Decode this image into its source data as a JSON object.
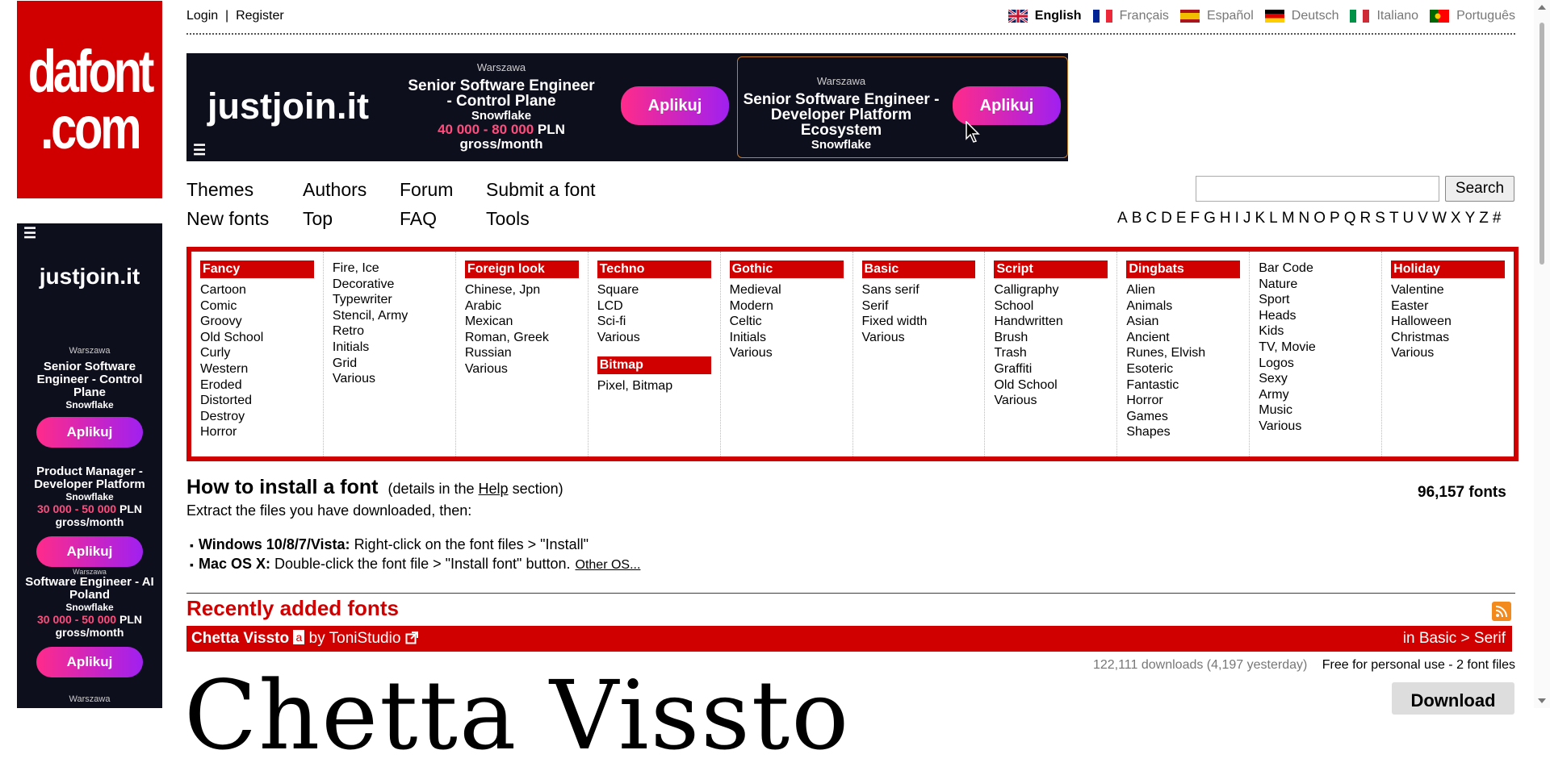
{
  "logo": {
    "line1": "dafont",
    "line2": ".com"
  },
  "side_ad": {
    "menu_icon": "menu-icon",
    "brand": "justjoin.it",
    "jobs": [
      {
        "city": "Warszawa",
        "title": "Senior Software Engineer - Control Plane",
        "company": "Snowflake",
        "salary_range": "",
        "salary_suffix": "",
        "cta": "Aplikuj"
      },
      {
        "city": "",
        "title": "Product Manager - Developer Platform",
        "company": "Snowflake",
        "salary_range": "30 000 - 50 000",
        "salary_suffix": "PLN",
        "salary_period": "gross/month",
        "cta": "Aplikuj"
      },
      {
        "city": "Warszawa",
        "title": "Software Engineer - AI Poland",
        "company": "Snowflake",
        "salary_range": "30 000 - 50 000",
        "salary_suffix": "PLN",
        "salary_period": "gross/month",
        "cta": "Aplikuj"
      },
      {
        "city": "Warszawa"
      }
    ]
  },
  "topbar": {
    "login": "Login",
    "separator": "|",
    "register": "Register",
    "languages": [
      {
        "label": "English",
        "flag": "uk-flag-icon",
        "active": true
      },
      {
        "label": "Français",
        "flag": "france-flag-icon"
      },
      {
        "label": "Español",
        "flag": "spain-flag-icon"
      },
      {
        "label": "Deutsch",
        "flag": "germany-flag-icon"
      },
      {
        "label": "Italiano",
        "flag": "italy-flag-icon"
      },
      {
        "label": "Português",
        "flag": "portugal-flag-icon"
      }
    ]
  },
  "banner": {
    "brand": "justjoin.it",
    "job1": {
      "city": "Warszawa",
      "title": "Senior Software Engineer - Control Plane",
      "company": "Snowflake",
      "salary_range": "40 000 - 80 000",
      "salary_suffix": "PLN",
      "salary_period": "gross/month",
      "cta": "Aplikuj"
    },
    "job2": {
      "city": "Warszawa",
      "title": "Senior Software Engineer - Developer Platform Ecosystem",
      "company": "Snowflake",
      "cta": "Aplikuj"
    }
  },
  "nav": {
    "themes": "Themes",
    "authors": "Authors",
    "forum": "Forum",
    "submit": "Submit a font",
    "new_fonts": "New fonts",
    "top": "Top",
    "faq": "FAQ",
    "tools": "Tools"
  },
  "search": {
    "placeholder": "",
    "button": "Search"
  },
  "alphabet": [
    "A",
    "B",
    "C",
    "D",
    "E",
    "F",
    "G",
    "H",
    "I",
    "J",
    "K",
    "L",
    "M",
    "N",
    "O",
    "P",
    "Q",
    "R",
    "S",
    "T",
    "U",
    "V",
    "W",
    "X",
    "Y",
    "Z",
    "#"
  ],
  "categories": [
    {
      "heading": "Fancy",
      "items": [
        "Cartoon",
        "Comic",
        "Groovy",
        "Old School",
        "Curly",
        "Western",
        "Eroded",
        "Distorted",
        "Destroy",
        "Horror"
      ]
    },
    {
      "heading": "",
      "items": [
        "Fire, Ice",
        "Decorative",
        "Typewriter",
        "Stencil, Army",
        "Retro",
        "Initials",
        "Grid",
        "Various"
      ]
    },
    {
      "heading": "Foreign look",
      "items": [
        "Chinese, Jpn",
        "Arabic",
        "Mexican",
        "Roman, Greek",
        "Russian",
        "Various"
      ]
    },
    {
      "heading": "Techno",
      "items": [
        "Square",
        "LCD",
        "Sci-fi",
        "Various"
      ],
      "heading2": "Bitmap",
      "items2": [
        "Pixel, Bitmap"
      ]
    },
    {
      "heading": "Gothic",
      "items": [
        "Medieval",
        "Modern",
        "Celtic",
        "Initials",
        "Various"
      ]
    },
    {
      "heading": "Basic",
      "items": [
        "Sans serif",
        "Serif",
        "Fixed width",
        "Various"
      ]
    },
    {
      "heading": "Script",
      "items": [
        "Calligraphy",
        "School",
        "Handwritten",
        "Brush",
        "Trash",
        "Graffiti",
        "Old School",
        "Various"
      ]
    },
    {
      "heading": "Dingbats",
      "items": [
        "Alien",
        "Animals",
        "Asian",
        "Ancient",
        "Runes, Elvish",
        "Esoteric",
        "Fantastic",
        "Horror",
        "Games",
        "Shapes"
      ]
    },
    {
      "heading": "",
      "items": [
        "Bar Code",
        "Nature",
        "Sport",
        "Heads",
        "Kids",
        "TV, Movie",
        "Logos",
        "Sexy",
        "Army",
        "Music",
        "Various"
      ]
    },
    {
      "heading": "Holiday",
      "items": [
        "Valentine",
        "Easter",
        "Halloween",
        "Christmas",
        "Various"
      ]
    }
  ],
  "install": {
    "title": "How to install a font",
    "details_prefix": "(details in the",
    "details_link": "Help",
    "details_suffix": "section)",
    "extract": "Extract the files you have downloaded, then:",
    "windows_label": "Windows 10/8/7/Vista:",
    "windows_text": "Right-click on the font files > \"Install\"",
    "mac_label": "Mac OS X:",
    "mac_text": "Double-click the font file > \"Install font\" button.",
    "other_os": "Other OS..."
  },
  "font_count": "96,157 fonts",
  "recent": {
    "title": "Recently added fonts",
    "font_name": "Chetta Vissto",
    "badge": "a",
    "by": "by",
    "author": "ToniStudio",
    "category": "in Basic > Serif",
    "downloads": "122,111 downloads (4,197 yesterday)",
    "license": "Free for personal use - 2 font files",
    "download_button": "Download",
    "preview_text": "Chetta Vissto"
  }
}
